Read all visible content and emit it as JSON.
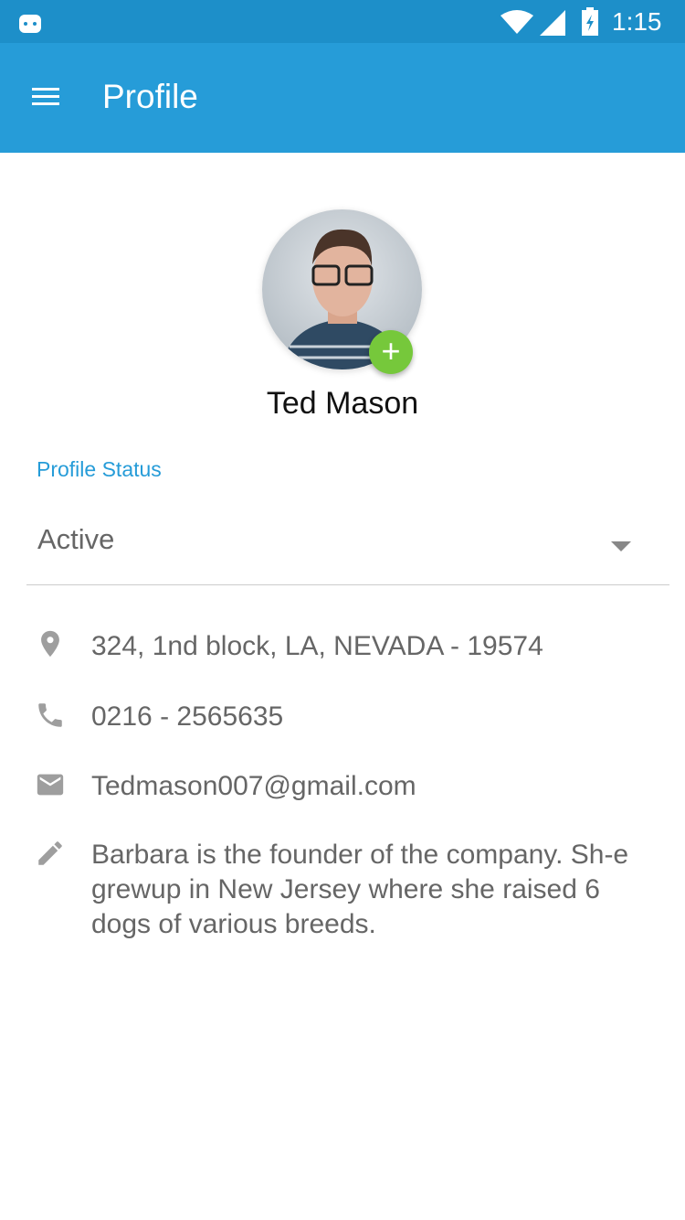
{
  "status_bar": {
    "time": "1:15",
    "icons": [
      "android-icon",
      "wifi-icon",
      "signal-icon",
      "battery-charging-icon"
    ]
  },
  "app_bar": {
    "title": "Profile",
    "menu_icon": "menu-icon"
  },
  "profile": {
    "name": "Ted Mason",
    "add_photo_icon": "plus-icon"
  },
  "status_field": {
    "label": "Profile Status",
    "value": "Active"
  },
  "details": {
    "address": "324, 1nd block, LA, NEVADA - 19574",
    "phone": "0216 - 2565635",
    "email": "Tedmason007@gmail.com",
    "bio": "Barbara is the founder of the company. Sh-e grewup in New Jersey where she raised 6 dogs of various breeds."
  },
  "colors": {
    "primary": "#269cd8",
    "status_bar": "#1d8fc9",
    "fab": "#76c83b"
  }
}
